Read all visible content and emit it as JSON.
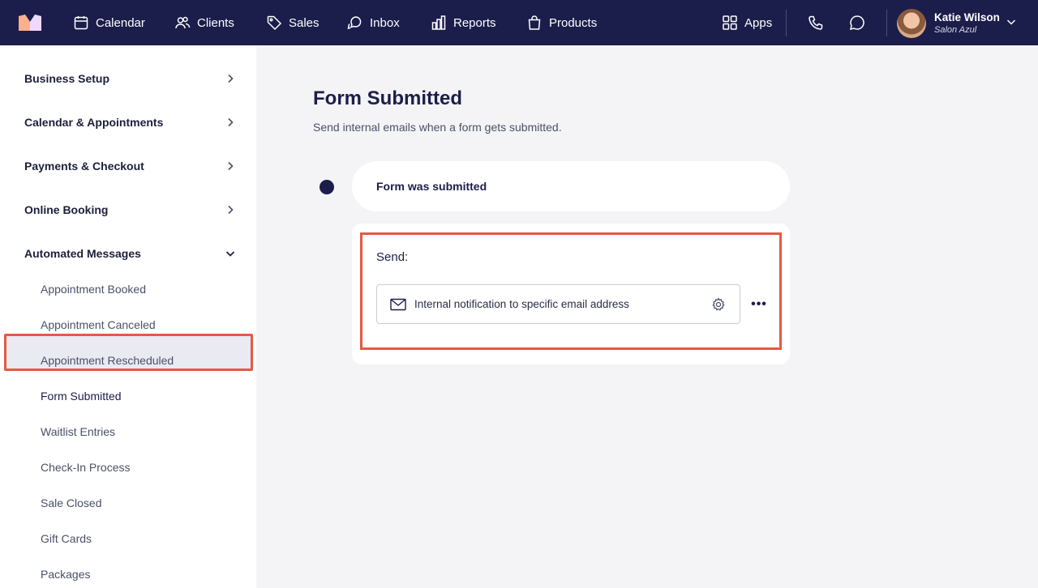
{
  "nav": {
    "items": [
      {
        "label": "Calendar",
        "icon": "calendar-icon"
      },
      {
        "label": "Clients",
        "icon": "users-icon"
      },
      {
        "label": "Sales",
        "icon": "tag-icon"
      },
      {
        "label": "Inbox",
        "icon": "chat-bubbles-icon"
      },
      {
        "label": "Reports",
        "icon": "bar-chart-icon"
      },
      {
        "label": "Products",
        "icon": "shopping-bag-icon"
      }
    ],
    "apps_label": "Apps",
    "user": {
      "name": "Katie Wilson",
      "business": "Salon Azul"
    }
  },
  "sidebar": {
    "sections": [
      {
        "label": "Business Setup",
        "expanded": false
      },
      {
        "label": "Calendar & Appointments",
        "expanded": false
      },
      {
        "label": "Payments & Checkout",
        "expanded": false
      },
      {
        "label": "Online Booking",
        "expanded": false
      },
      {
        "label": "Automated Messages",
        "expanded": true
      }
    ],
    "sub_items": [
      {
        "label": "Appointment Booked"
      },
      {
        "label": "Appointment Canceled"
      },
      {
        "label": "Appointment Rescheduled"
      },
      {
        "label": "Form Submitted",
        "active": true
      },
      {
        "label": "Waitlist Entries"
      },
      {
        "label": "Check-In Process"
      },
      {
        "label": "Sale Closed"
      },
      {
        "label": "Gift Cards"
      },
      {
        "label": "Packages"
      }
    ]
  },
  "main": {
    "title": "Form Submitted",
    "description": "Send internal emails when a form gets submitted.",
    "trigger_label": "Form was submitted",
    "send_label": "Send:",
    "action_label": "Internal notification to specific email address",
    "more_label": "•••"
  },
  "colors": {
    "nav_bg": "#1b1e4b",
    "highlight": "#e45a43",
    "active_item_bg": "#e9eaf2",
    "page_bg": "#f4f4f6"
  }
}
